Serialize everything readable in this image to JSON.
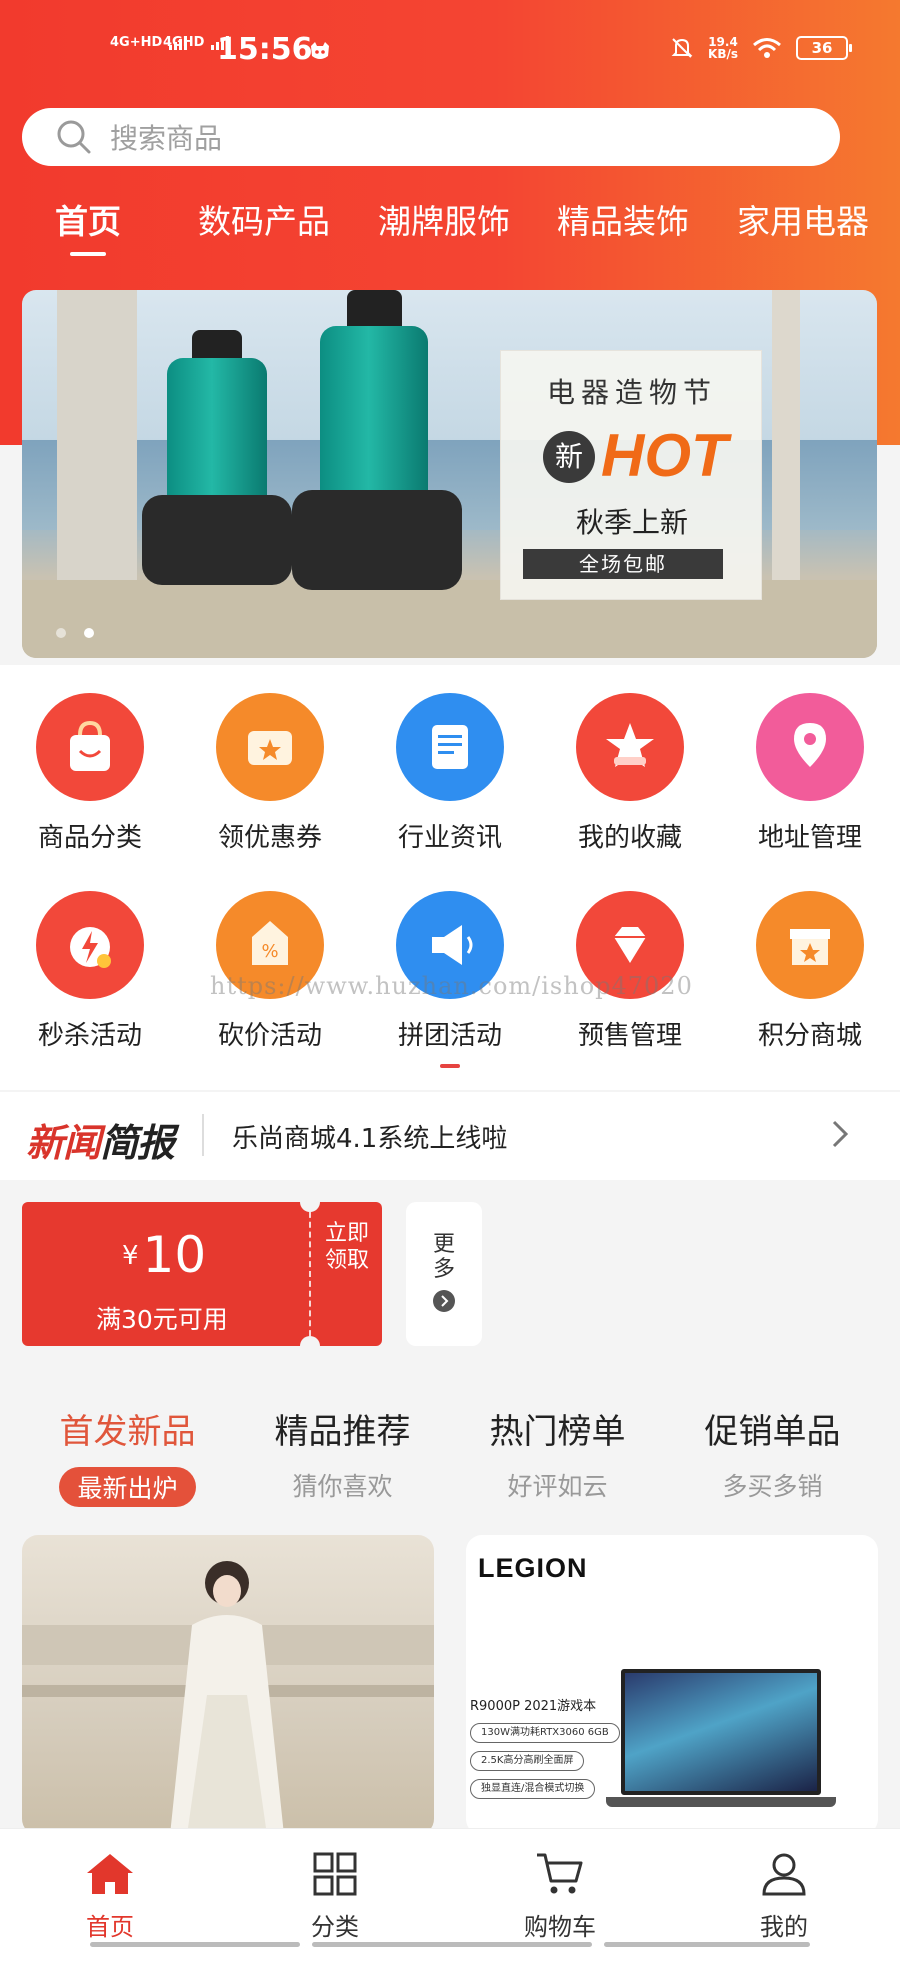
{
  "status_bar": {
    "signal1": "4G+HD",
    "signal2": "4GHD",
    "time": "15:56",
    "net_speed_value": "19.4",
    "net_speed_unit": "KB/s",
    "battery": "36"
  },
  "search": {
    "placeholder": "搜索商品"
  },
  "category_tabs": [
    {
      "label": "首页",
      "active": true
    },
    {
      "label": "数码产品"
    },
    {
      "label": "潮牌服饰"
    },
    {
      "label": "精品装饰"
    },
    {
      "label": "家用电器"
    }
  ],
  "banner": {
    "line1": "电器造物节",
    "badge": "新",
    "hot": "HOT",
    "line2": "秋季上新",
    "line3": "全场包邮",
    "page_count": 2,
    "current_page": 1
  },
  "icon_grid": [
    {
      "label": "商品分类",
      "icon": "shopping-bag-icon",
      "color": "#f2483a"
    },
    {
      "label": "领优惠券",
      "icon": "coupon-icon",
      "color": "#f58a2a"
    },
    {
      "label": "行业资讯",
      "icon": "document-icon",
      "color": "#2f8ef0"
    },
    {
      "label": "我的收藏",
      "icon": "favorites-icon",
      "color": "#f2483a"
    },
    {
      "label": "地址管理",
      "icon": "location-icon",
      "color": "#f25c9a"
    },
    {
      "label": "秒杀活动",
      "icon": "flash-sale-icon",
      "color": "#f2483a"
    },
    {
      "label": "砍价活动",
      "icon": "discount-tag-icon",
      "color": "#f58a2a"
    },
    {
      "label": "拼团活动",
      "icon": "megaphone-icon",
      "color": "#2f8ef0"
    },
    {
      "label": "预售管理",
      "icon": "diamond-icon",
      "color": "#f2483a"
    },
    {
      "label": "积分商城",
      "icon": "store-icon",
      "color": "#f58a2a"
    }
  ],
  "watermark": "https://www.huzhan.com/ishop47020",
  "news": {
    "logo_red": "新闻",
    "logo_black": "简报",
    "text": "乐尚商城4.1系统上线啦"
  },
  "coupon": {
    "currency": "¥",
    "amount": "10",
    "condition": "满30元可用",
    "claim": "立即领取",
    "more": "更多"
  },
  "section_tabs": [
    {
      "title": "首发新品",
      "subtitle": "最新出炉",
      "active": true
    },
    {
      "title": "精品推荐",
      "subtitle": "猜你喜欢"
    },
    {
      "title": "热门榜单",
      "subtitle": "好评如云"
    },
    {
      "title": "促销单品",
      "subtitle": "多买多销"
    }
  ],
  "product_cards": {
    "card2": {
      "brand": "LEGION",
      "title": "R9000P 2021游戏本",
      "pill1": "130W满功耗RTX3060 6GB",
      "pill2": "2.5K高分高刷全面屏",
      "pill3": "独显直连/混合模式切换"
    }
  },
  "bottom_nav": [
    {
      "label": "首页",
      "icon": "home-icon",
      "active": true
    },
    {
      "label": "分类",
      "icon": "grid-icon"
    },
    {
      "label": "购物车",
      "icon": "cart-icon"
    },
    {
      "label": "我的",
      "icon": "user-icon"
    }
  ],
  "colors": {
    "brand": "#f23a2d",
    "accent": "#e0563b"
  }
}
